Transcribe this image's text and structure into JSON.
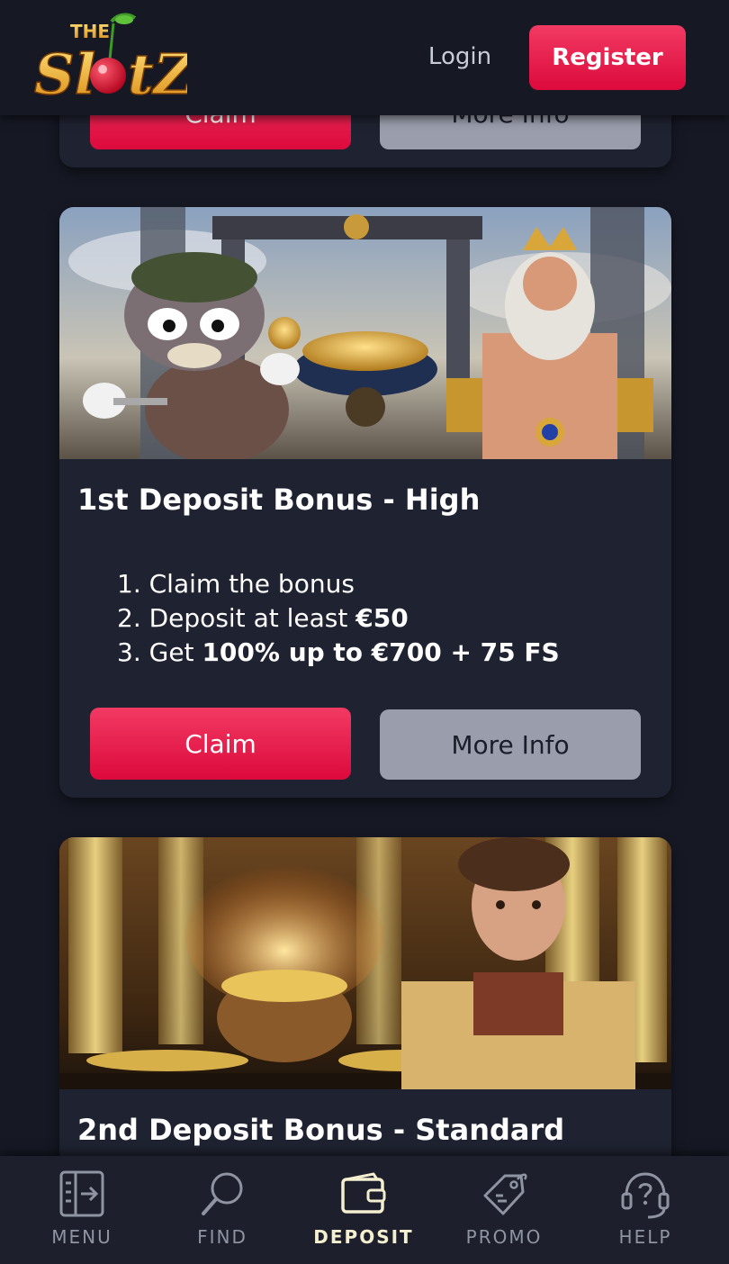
{
  "header": {
    "logo_text_top": "THE",
    "logo_text_main": "SlotZ",
    "login_label": "Login",
    "register_label": "Register"
  },
  "previous_card": {
    "claim_label": "Claim",
    "more_info_label": "More Info"
  },
  "cards": [
    {
      "title": "1st Deposit Bonus - High",
      "steps": [
        {
          "num": "1.",
          "text": "Claim the bonus",
          "bold": ""
        },
        {
          "num": "2.",
          "text": "Deposit at least ",
          "bold": "€50"
        },
        {
          "num": "3.",
          "text": "Get ",
          "bold": "100% up to €700 + 75 FS"
        }
      ],
      "claim_label": "Claim",
      "more_info_label": "More Info"
    },
    {
      "title": "2nd Deposit Bonus - Standard"
    }
  ],
  "bottom_nav": [
    {
      "label": "MENU",
      "icon": "menu-icon"
    },
    {
      "label": "FIND",
      "icon": "search-icon"
    },
    {
      "label": "DEPOSIT",
      "icon": "wallet-icon",
      "active": true
    },
    {
      "label": "PROMO",
      "icon": "tag-icon"
    },
    {
      "label": "HELP",
      "icon": "help-icon"
    }
  ],
  "colors": {
    "background": "#161924",
    "card": "#1f2230",
    "accent": "#e8164a",
    "secondary_button": "#9a9dab",
    "active_nav": "#f4efcf"
  }
}
